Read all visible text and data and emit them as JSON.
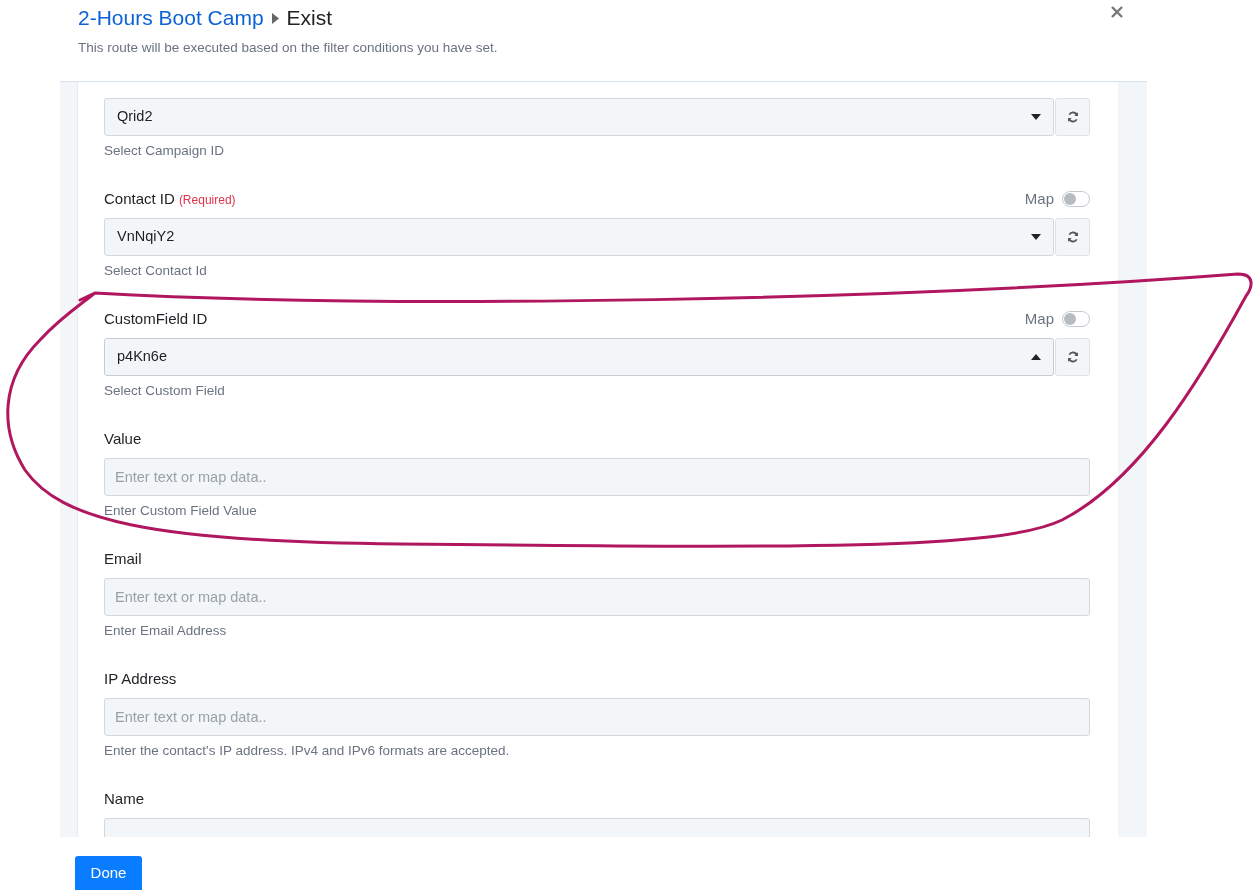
{
  "header": {
    "breadcrumb": [
      {
        "label": "2-Hours Boot Camp",
        "kind": "link"
      },
      {
        "label": "Exist",
        "kind": "current"
      }
    ],
    "subtitle": "This route will be executed based on the filter conditions you have set."
  },
  "fields": [
    {
      "kind": "select",
      "value": "Qrid2",
      "expanded": false,
      "hint": "Select Campaign ID"
    },
    {
      "kind": "select",
      "label": "Contact ID",
      "required": "(Required)",
      "map": {
        "label": "Map",
        "on": false
      },
      "value": "VnNqiY2",
      "expanded": false,
      "hint": "Select Contact Id"
    },
    {
      "kind": "select",
      "label": "CustomField ID",
      "map": {
        "label": "Map",
        "on": false
      },
      "value": "p4Kn6e",
      "expanded": true,
      "hint": "Select Custom Field"
    },
    {
      "kind": "text",
      "label": "Value",
      "placeholder": "Enter text or map data..",
      "hint": "Enter Custom Field Value"
    },
    {
      "kind": "text",
      "label": "Email",
      "placeholder": "Enter text or map data..",
      "hint": "Enter Email Address"
    },
    {
      "kind": "text",
      "label": "IP Address",
      "placeholder": "Enter text or map data..",
      "hint": "Enter the contact's IP address. IPv4 and IPv6 formats are accepted."
    },
    {
      "kind": "text",
      "label": "Name"
    }
  ],
  "done_button": "Done"
}
